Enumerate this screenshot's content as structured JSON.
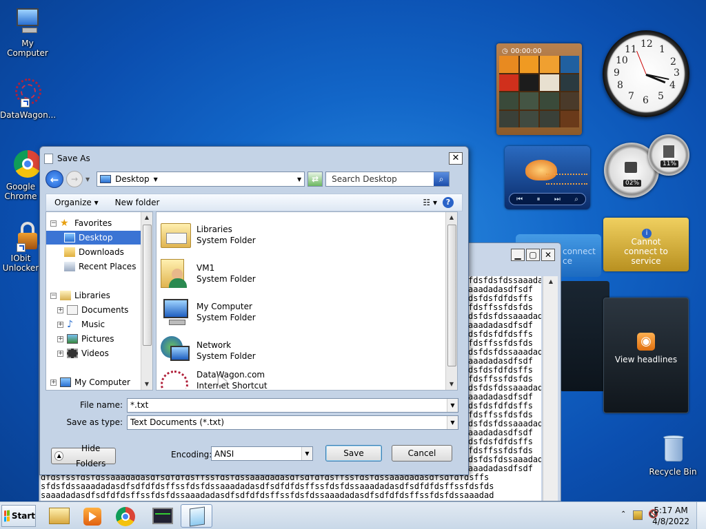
{
  "desktop": {
    "icons": [
      {
        "label": "My Computer"
      },
      {
        "label": "DataWagon..."
      },
      {
        "label": "Google Chrome"
      },
      {
        "label": "IObit Unlocker"
      },
      {
        "label": "Recycle Bin"
      }
    ]
  },
  "gadgets": {
    "puzzle_timer": "00:00:00",
    "clock_numbers": [
      "12",
      "1",
      "2",
      "3",
      "4",
      "5",
      "6",
      "7",
      "8",
      "9",
      "10",
      "11"
    ],
    "cpu_percent": "02%",
    "mem_percent": "11%",
    "weather_message": "Cannot connect to service",
    "weather_message_back": "connect ce",
    "feeds_label": "View headlines"
  },
  "notepad": {
    "text_lines": [
      "fdsfdsfdssaaadad",
      "aaadadasdfsdf",
      "dsfdsfdfdsffs",
      "fdsffssfdsfds",
      "dsfdsfdssaaadad",
      "aaadadasdfsdf",
      "dsfdsfdfdsffs",
      "fdsffssfdsfds",
      "dsfdsfdssaaadad",
      "aaadadasdfsdf",
      "dsfdsfdfdsffs",
      "fdsffssfdsfds",
      "dsfdsfdssaaadad",
      "aaadadasdfsdf",
      "dsfdsfdfdsffs",
      "fdsffssfdsfds",
      "dsfdsfdssaaadad",
      "aaadadasdfsdf",
      "dsfdsfdfdsffs",
      "fdsffssfdsfds",
      "dsfdsfdssaaadad",
      "aaadadasdfsdf"
    ],
    "wide_lines": [
      "dfdsfssfdsfdssaaadadasdfsdfdfdsffssfdsfdssaaadadasdfsdfdfdsffssfdsfdssaaadadasdfsdfdfdsffs",
      "sfdsfdssaaadadasdfsdfdfdsffssfdsfdssaaadadasdfsdfdfdsffssfdsfdssaaadadasdfsdfdfdsffssfdsfds",
      "saaadadasdfsdfdfdsffssfdsfdssaaadadasdfsdfdfdsffssfdsfdssaaadadasdfsdfdfdsffssfdsfdssaaadad"
    ]
  },
  "dialog": {
    "title": "Save As",
    "close": "✕",
    "address": "Desktop",
    "search_placeholder": "Search Desktop",
    "toolbar": {
      "organize": "Organize",
      "new_folder": "New folder"
    },
    "nav_tree": [
      {
        "label": "Favorites",
        "expander": "⊟"
      },
      {
        "label": "Desktop"
      },
      {
        "label": "Downloads"
      },
      {
        "label": "Recent Places"
      },
      {
        "label": "Libraries",
        "expander": "⊟"
      },
      {
        "label": "Documents",
        "expander": "+"
      },
      {
        "label": "Music",
        "expander": "+"
      },
      {
        "label": "Pictures",
        "expander": "+"
      },
      {
        "label": "Videos",
        "expander": "+"
      },
      {
        "label": "My Computer",
        "expander": "+"
      }
    ],
    "files": [
      {
        "name": "Libraries",
        "type": "System Folder"
      },
      {
        "name": "VM1",
        "type": "System Folder"
      },
      {
        "name": "My Computer",
        "type": "System Folder"
      },
      {
        "name": "Network",
        "type": "System Folder"
      },
      {
        "name": "DataWagon.com",
        "type": "Internet Shortcut"
      }
    ],
    "file_name_label": "File name:",
    "file_name_value": "*.txt",
    "save_type_label": "Save as type:",
    "save_type_value": "Text Documents (*.txt)",
    "hide_folders": "Hide Folders",
    "encoding_label": "Encoding:",
    "encoding_value": "ANSI",
    "save": "Save",
    "cancel": "Cancel"
  },
  "taskbar": {
    "start": "Start",
    "time": "5:17 AM",
    "date": "4/8/2022"
  },
  "colors": {
    "selection": "#3b74d4",
    "desktop": "#1266c8"
  }
}
